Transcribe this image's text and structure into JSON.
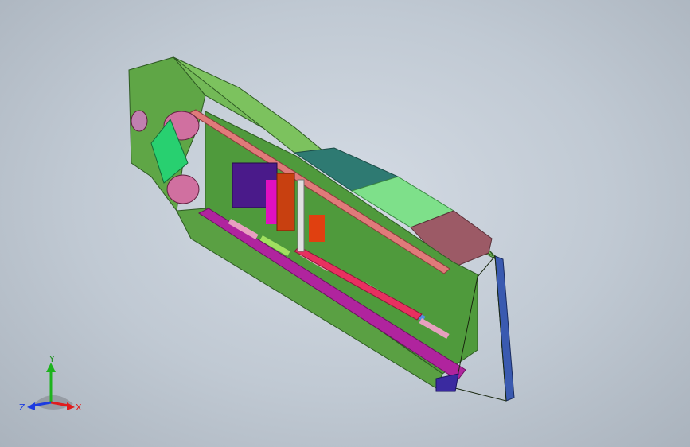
{
  "viewport": {
    "background_center": "#d4dbe4",
    "background_edge": "#aab3bd"
  },
  "model": {
    "parts": [
      {
        "name": "hull-outer-shell",
        "color": "#6cb04e"
      },
      {
        "name": "roof-panel-teal",
        "color": "#2e7a72"
      },
      {
        "name": "roof-panel-lightgreen",
        "color": "#7ee08a"
      },
      {
        "name": "roof-panel-mauve",
        "color": "#9c5a66"
      },
      {
        "name": "floor-beam-magenta",
        "color": "#b0249e"
      },
      {
        "name": "handrail-salmon",
        "color": "#e07a7a"
      },
      {
        "name": "seat-purple",
        "color": "#4a1a8a"
      },
      {
        "name": "door-panel-blue",
        "color": "#3a5ab0"
      }
    ]
  },
  "triad": {
    "axis_y": "Y",
    "axis_x": "X",
    "axis_z": "Z",
    "color_y": "#1db31d",
    "color_x": "#e01c1c",
    "color_z": "#1c3be0"
  }
}
